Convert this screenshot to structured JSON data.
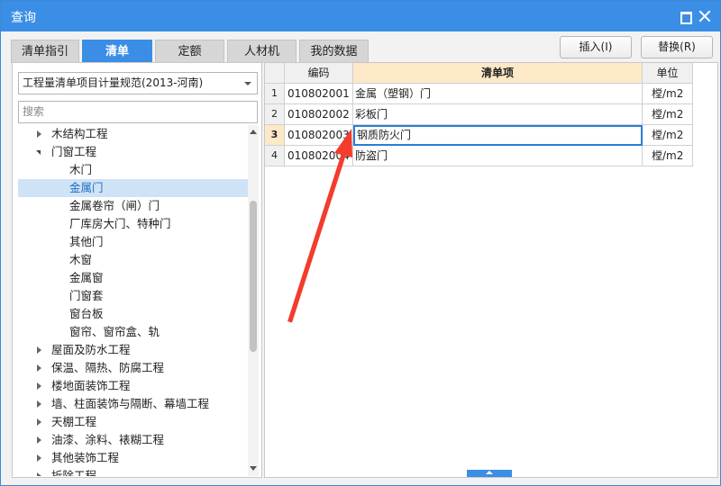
{
  "window": {
    "title": "查询"
  },
  "tabs": [
    "清单指引",
    "清单",
    "定额",
    "人材机",
    "我的数据"
  ],
  "active_tab": 1,
  "buttons": {
    "insert": "插入(I)",
    "replace": "替换(R)"
  },
  "left": {
    "spec_select": "工程量清单项目计量规范(2013-河南)",
    "search_placeholder": "搜索",
    "tree": [
      {
        "label": "木结构工程",
        "level": 1,
        "state": "closed"
      },
      {
        "label": "门窗工程",
        "level": 1,
        "state": "open"
      },
      {
        "label": "木门",
        "level": 2
      },
      {
        "label": "金属门",
        "level": 2,
        "selected": true
      },
      {
        "label": "金属卷帘（闸）门",
        "level": 2
      },
      {
        "label": "厂库房大门、特种门",
        "level": 2
      },
      {
        "label": "其他门",
        "level": 2
      },
      {
        "label": "木窗",
        "level": 2
      },
      {
        "label": "金属窗",
        "level": 2
      },
      {
        "label": "门窗套",
        "level": 2
      },
      {
        "label": "窗台板",
        "level": 2
      },
      {
        "label": "窗帘、窗帘盒、轨",
        "level": 2
      },
      {
        "label": "屋面及防水工程",
        "level": 1,
        "state": "closed"
      },
      {
        "label": "保温、隔热、防腐工程",
        "level": 1,
        "state": "closed"
      },
      {
        "label": "楼地面装饰工程",
        "level": 1,
        "state": "closed"
      },
      {
        "label": "墙、柱面装饰与隔断、幕墙工程",
        "level": 1,
        "state": "closed"
      },
      {
        "label": "天棚工程",
        "level": 1,
        "state": "closed"
      },
      {
        "label": "油漆、涂料、裱糊工程",
        "level": 1,
        "state": "closed"
      },
      {
        "label": "其他装饰工程",
        "level": 1,
        "state": "closed"
      },
      {
        "label": "拆除工程",
        "level": 1,
        "state": "closed"
      }
    ]
  },
  "grid": {
    "columns": [
      "编码",
      "清单项",
      "单位"
    ],
    "rows": [
      {
        "num": "1",
        "code": "010802001",
        "name": "金属（塑钢）门",
        "unit": "樘/m2"
      },
      {
        "num": "2",
        "code": "010802002",
        "name": "彩板门",
        "unit": "樘/m2"
      },
      {
        "num": "3",
        "code": "010802003",
        "name": "钢质防火门",
        "unit": "樘/m2"
      },
      {
        "num": "4",
        "code": "010802004",
        "name": "防盗门",
        "unit": "樘/m2"
      }
    ],
    "current_row": 2
  },
  "colors": {
    "accent": "#3a8ee6",
    "arrow": "#f23c2c",
    "selection": "#cfe3f7",
    "header_highlight": "#fde9c8"
  }
}
